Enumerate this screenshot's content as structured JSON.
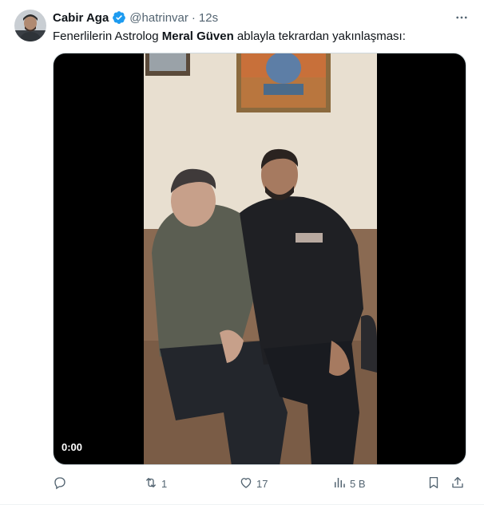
{
  "tweet": {
    "author": {
      "display_name": "Cabir Aga",
      "handle": "@hatrinvar",
      "verified": true,
      "avatar_icon": "profile-photo"
    },
    "separator": "·",
    "time": "12s",
    "text": {
      "before": "Fenerlilerin Astrolog ",
      "bold": "Meral Güven",
      "after": " ablayla tekrardan yakınlaşması:"
    },
    "media": {
      "type": "video",
      "timestamp": "0:00"
    },
    "actions": {
      "reply_count": "",
      "retweet_count": "1",
      "like_count": "17",
      "views_count": "5 B"
    }
  },
  "colors": {
    "accent": "#1d9bf0",
    "secondary_text": "#536471",
    "primary_text": "#0f1419",
    "border": "#cfd9de"
  },
  "icons": [
    "verified-badge-icon",
    "more-icon",
    "reply-icon",
    "retweet-icon",
    "like-icon",
    "views-icon",
    "bookmark-icon",
    "share-icon"
  ]
}
